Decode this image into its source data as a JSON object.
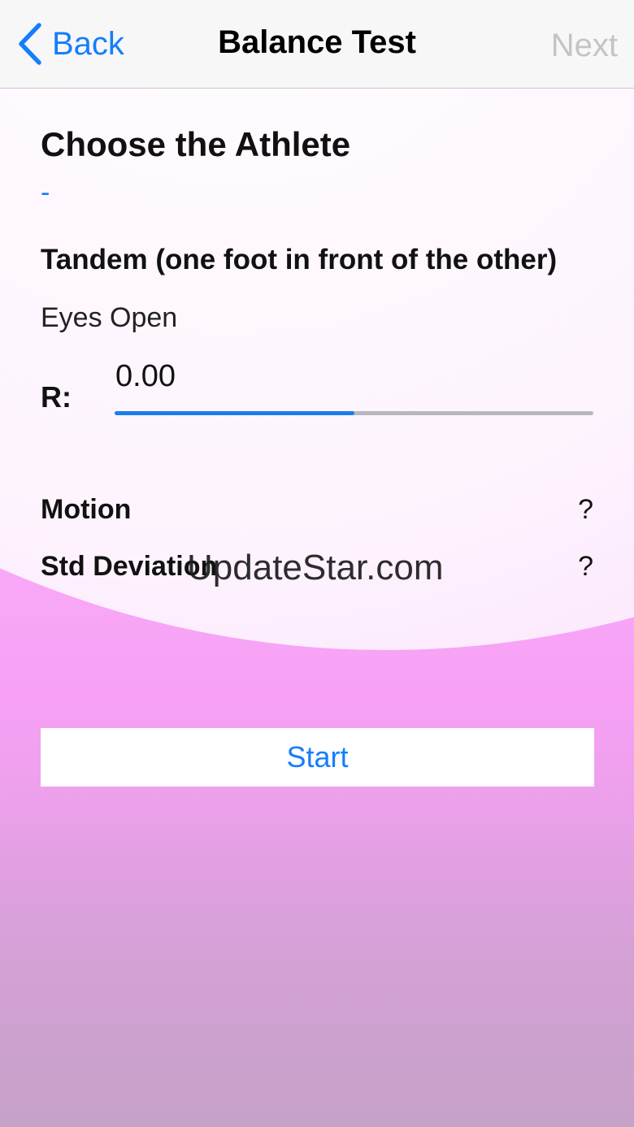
{
  "navbar": {
    "back_label": "Back",
    "title": "Balance Test",
    "next_label": "Next"
  },
  "athlete": {
    "heading": "Choose the Athlete",
    "value": "-"
  },
  "test": {
    "type": "Tandem (one foot in front of the other)",
    "eyes": "Eyes Open"
  },
  "r_reading": {
    "label": "R:",
    "value": "0.00",
    "progress": 0.5
  },
  "metrics": [
    {
      "label": "Motion",
      "help": "?"
    },
    {
      "label": "Std Deviation",
      "help": "?"
    }
  ],
  "watermark": "UpdateStar.com",
  "start_label": "Start",
  "colors": {
    "accent": "#157efb",
    "disabled": "#c4c4c6",
    "track": "#b8b8bc"
  }
}
